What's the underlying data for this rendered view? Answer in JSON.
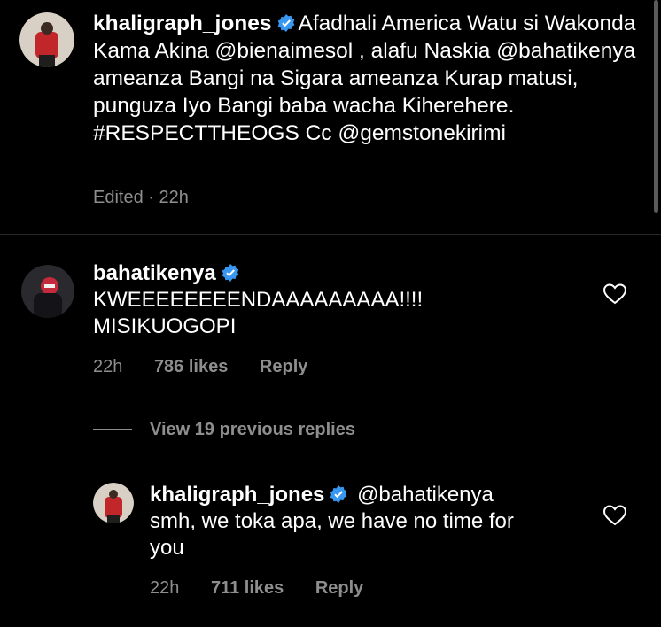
{
  "post": {
    "username": "khaligraph_jones",
    "caption": "Afadhali America Watu si Wakonda Kama Akina @bienaimesol , alafu Naskia @bahatikenya ameanza Bangi na Sigara ameanza Kurap matusi, punguza Iyo Bangi baba wacha Kiherehere. #RESPECTTHEOGS  Cc @gemstonekirimi",
    "edited_label": "Edited · 22h"
  },
  "comment": {
    "username": "bahatikenya",
    "text_line1": "KWEEEEEEEENDAAAAAAAAA!!!!",
    "text_line2": "MISIKUOGOPI",
    "time": "22h",
    "likes": "786 likes",
    "reply_label": "Reply"
  },
  "view_replies_label": "View 19 previous replies",
  "reply": {
    "username": "khaligraph_jones",
    "mention": "@bahatikenya",
    "text_line1": "smh, we toka apa, we have no time for",
    "text_line2": "you",
    "time": "22h",
    "likes": "711 likes",
    "reply_label": "Reply"
  },
  "colors": {
    "background": "#000000",
    "text": "#ffffff",
    "secondary": "#8e8e8e",
    "verified": "#3897f0"
  },
  "icons": [
    "verified-badge-icon",
    "heart-icon"
  ]
}
